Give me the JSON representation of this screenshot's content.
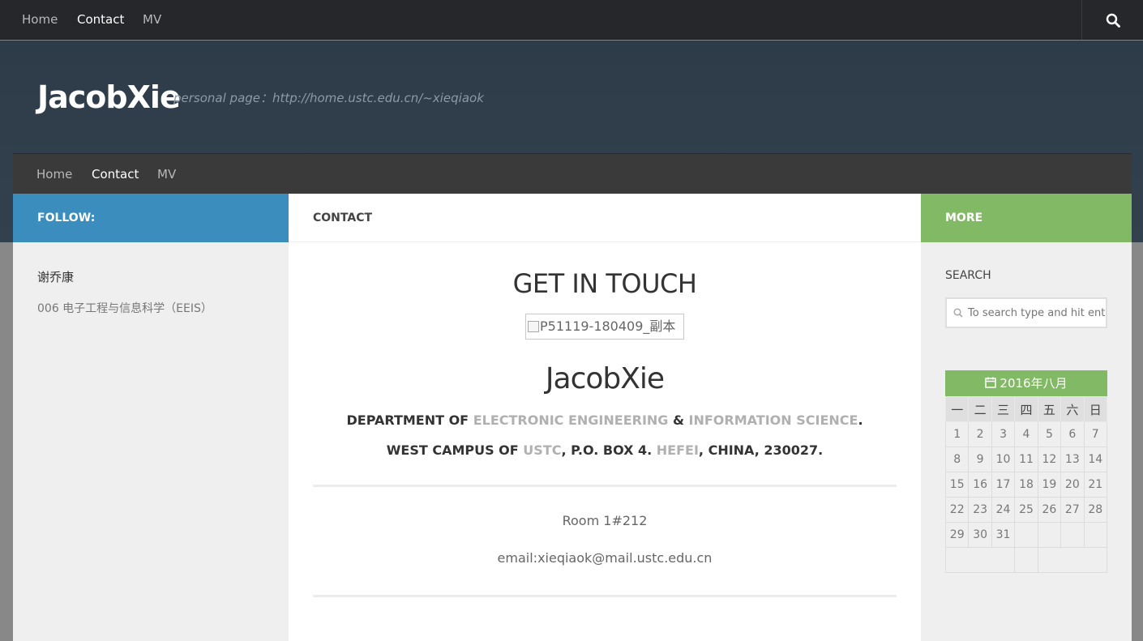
{
  "topnav": {
    "items": [
      "Home",
      "Contact",
      "MV"
    ],
    "active": "Contact"
  },
  "header": {
    "title": "JacobXie",
    "description": "personal page：http://home.ustc.edu.cn/~xieqiaok"
  },
  "subnav": {
    "items": [
      "Home",
      "Contact",
      "MV"
    ],
    "active": "Contact"
  },
  "left": {
    "heading": "FOLLOW:",
    "name": "谢乔康",
    "department": "006 电子工程与信息科学（EEIS）"
  },
  "main": {
    "heading": "CONTACT",
    "title": "GET IN TOUCH",
    "photo_alt": "P51119-180409_副本",
    "name": "JacobXie",
    "line1": [
      "DEPARTMENT OF ",
      "ELECTRONIC ENGINEERING",
      " & ",
      "INFORMATION SCIENCE",
      "."
    ],
    "line2": [
      "WEST CAMPUS OF ",
      "USTC",
      ", P.O. BOX 4. ",
      "HEFEI",
      ", CHINA, 230027."
    ],
    "room": "Room 1#212",
    "email": "email:xieqiaok@mail.ustc.edu.cn"
  },
  "right": {
    "heading": "MORE",
    "search_label": "SEARCH",
    "search_placeholder": "To search type and hit enter",
    "calendar": {
      "caption": "2016年八月",
      "weekdays": [
        "一",
        "二",
        "三",
        "四",
        "五",
        "六",
        "日"
      ],
      "weeks": [
        [
          "1",
          "2",
          "3",
          "4",
          "5",
          "6",
          "7"
        ],
        [
          "8",
          "9",
          "10",
          "11",
          "12",
          "13",
          "14"
        ],
        [
          "15",
          "16",
          "17",
          "18",
          "19",
          "20",
          "21"
        ],
        [
          "22",
          "23",
          "24",
          "25",
          "26",
          "27",
          "28"
        ],
        [
          "29",
          "30",
          "31",
          "",
          "",
          "",
          ""
        ]
      ]
    }
  },
  "colors": {
    "follow_blue": "#3b8dbd",
    "more_green": "#82b965",
    "header_bg": "#2e3b49",
    "topbar_bg": "#26272b"
  },
  "icons": {
    "search": "search-icon",
    "calendar": "calendar-icon"
  }
}
